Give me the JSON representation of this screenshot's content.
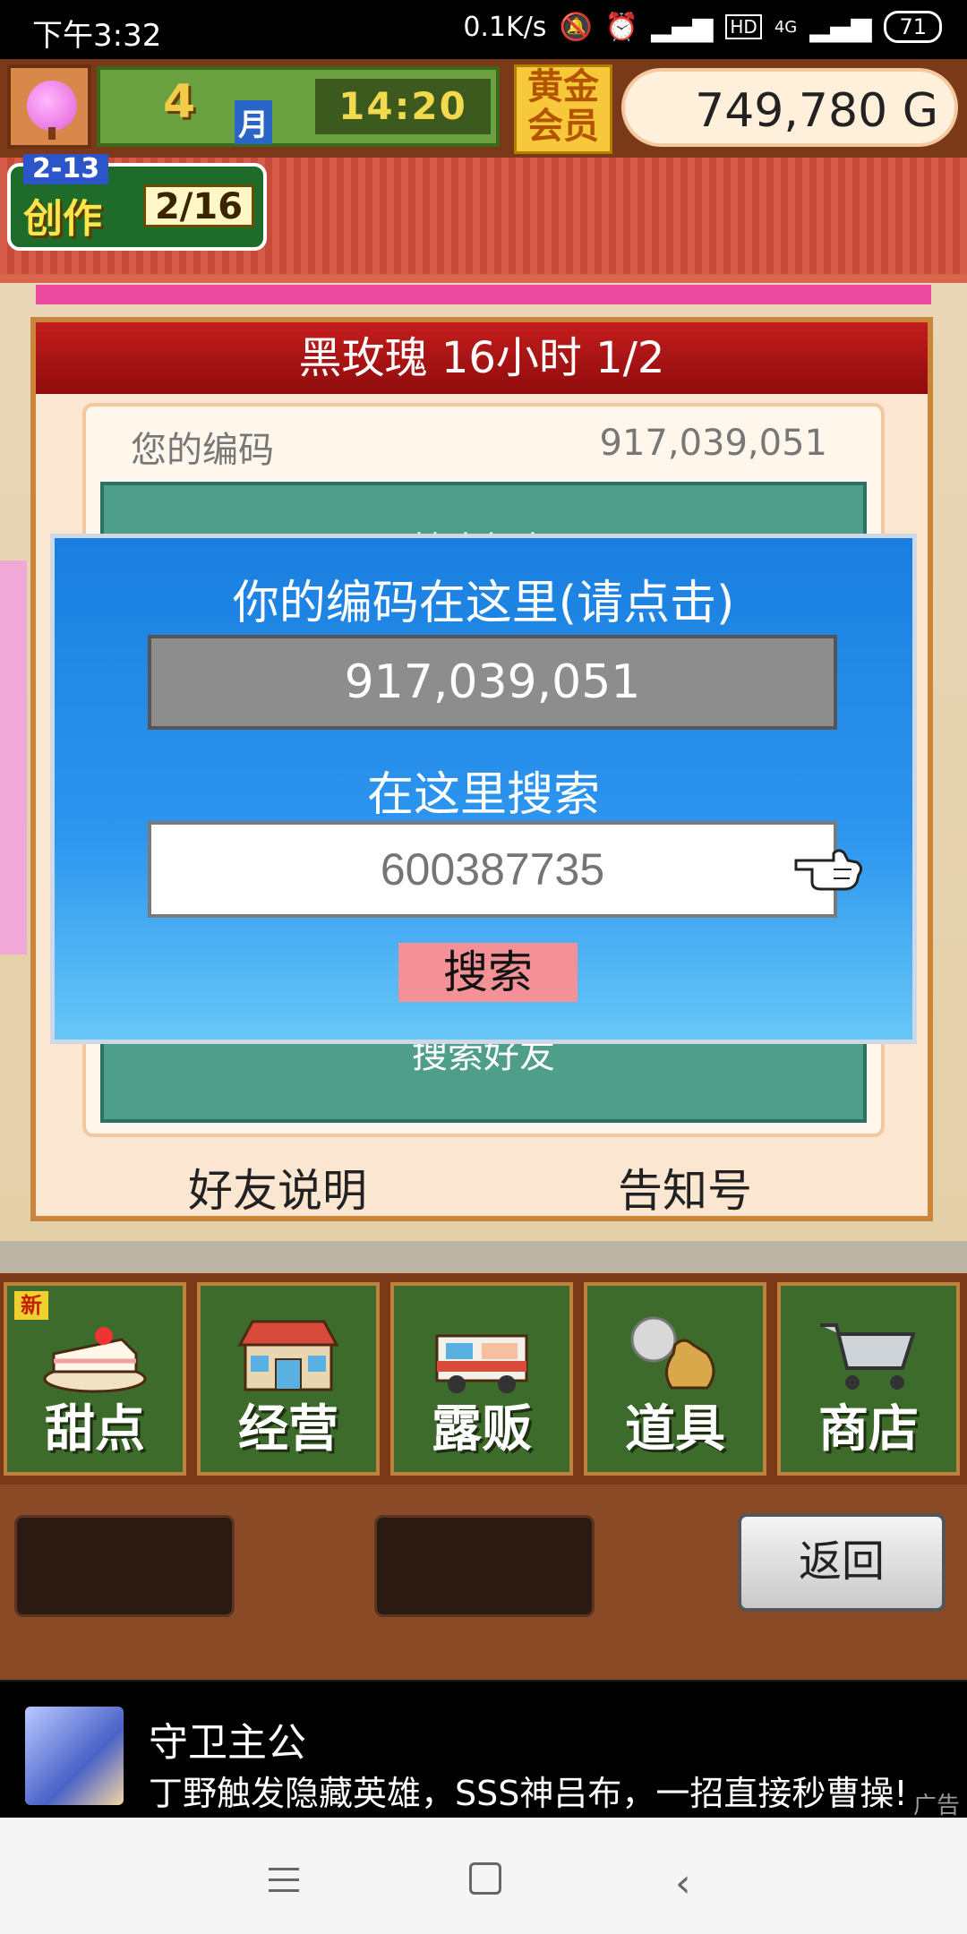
{
  "status_bar": {
    "time": "下午3:32",
    "network_speed": "0.1K/s",
    "hd_badge": "HD",
    "network_type": "4G",
    "battery": "71"
  },
  "hud": {
    "month_number": "4",
    "month_label": "月",
    "clock": "14:20",
    "gold_member": "黄金会员",
    "money": "749,780 G"
  },
  "creation": {
    "small_label": "2-13",
    "label": "创作",
    "progress": "2/16"
  },
  "panel": {
    "title": "黑玫瑰  16小时 1/2",
    "code_label": "您的编码",
    "code_value": "917,039,051",
    "search_friend_top": "搜索好友",
    "search_friend_bottom": "搜索好友",
    "help_label": "好友说明",
    "notify_label": "告知号"
  },
  "dialog": {
    "title": "你的编码在这里(请点击)",
    "code": "917,039,051",
    "search_title": "在这里搜索",
    "search_placeholder": "600387735",
    "search_button": "搜索"
  },
  "menu": [
    {
      "label": "甜点",
      "icon": "cake-icon",
      "badge": "新"
    },
    {
      "label": "经营",
      "icon": "shop-icon"
    },
    {
      "label": "露贩",
      "icon": "food-truck-icon"
    },
    {
      "label": "道具",
      "icon": "items-bag-icon"
    },
    {
      "label": "商店",
      "icon": "cart-icon"
    }
  ],
  "bottom": {
    "back_label": "返回"
  },
  "ad": {
    "title": "守卫主公",
    "description": "丁野触发隐藏英雄，SSS神吕布，一招直接秒曹操!",
    "tag": "广告"
  },
  "colors": {
    "dialog_blue": "#1a7fe0",
    "search_button": "#f39197",
    "panel_title_red": "#c41d1d",
    "menu_green": "#3d6b2c"
  }
}
